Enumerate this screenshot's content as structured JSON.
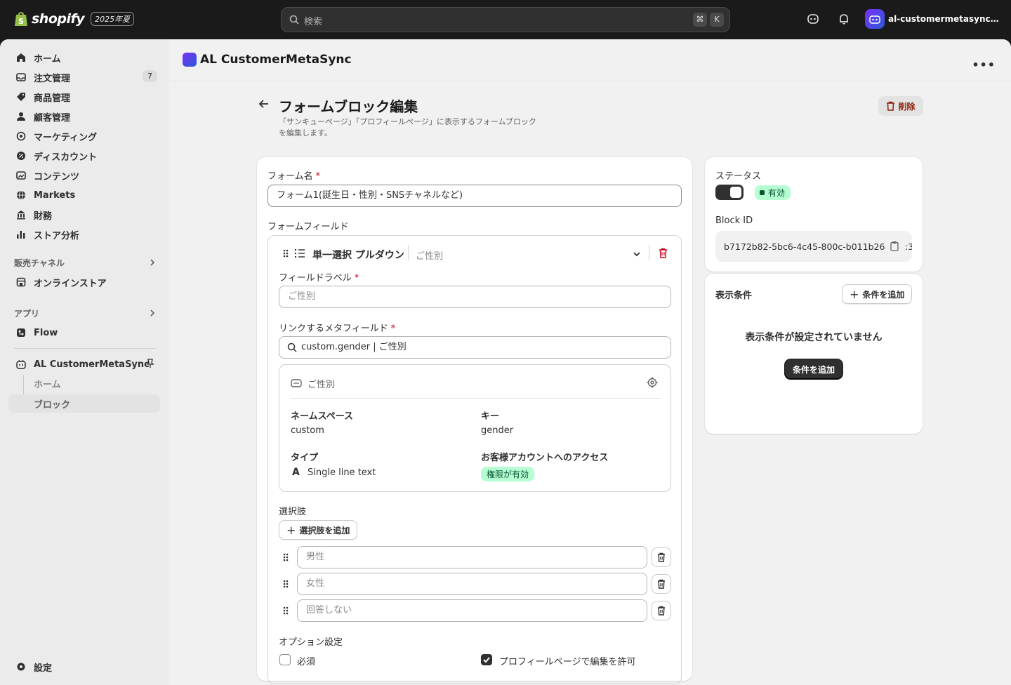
{
  "topbar": {
    "brand": "shopify",
    "edition": "2025年夏",
    "search_placeholder": "検索",
    "shortcut_cmd": "⌘",
    "shortcut_key": "K",
    "store_name": "al-customermetasync-de..."
  },
  "sidebar": {
    "items": [
      {
        "label": "ホーム"
      },
      {
        "label": "注文管理",
        "badge": "7"
      },
      {
        "label": "商品管理"
      },
      {
        "label": "顧客管理"
      },
      {
        "label": "マーケティング"
      },
      {
        "label": "ディスカウント"
      },
      {
        "label": "コンテンツ"
      },
      {
        "label": "Markets"
      },
      {
        "label": "財務"
      },
      {
        "label": "ストア分析"
      }
    ],
    "sales_channels_title": "販売チャネル",
    "online_store": "オンラインストア",
    "apps_title": "アプリ",
    "flow": "Flow",
    "app_name": "AL CustomerMetaSync",
    "app_sub_home": "ホーム",
    "app_sub_block": "ブロック",
    "settings": "設定"
  },
  "app_header": {
    "title": "AL CustomerMetaSync"
  },
  "page": {
    "title": "フォームブロック編集",
    "subtitle": "「サンキューページ」「プロフィールページ」に表示するフォームブロックを編集します。",
    "delete_label": "削除"
  },
  "form": {
    "name_label": "フォーム名",
    "name_value": "フォーム1(誕生日・性別・SNSチャネルなど)",
    "fields_label": "フォームフィールド",
    "field": {
      "type_label": "単一選択 プルダウン",
      "type_sub": "ご性別",
      "field_label_label": "フィールドラベル",
      "field_label_placeholder": "ご性別",
      "metafield_label": "リンクするメタフィールド",
      "metafield_value": "custom.gender | ご性別",
      "meta": {
        "name": "ご性別",
        "namespace_label": "ネームスペース",
        "namespace_value": "custom",
        "key_label": "キー",
        "key_value": "gender",
        "type_label": "タイプ",
        "type_value": "Single line text",
        "access_label": "お客様アカウントへのアクセス",
        "access_value": "権限が有効"
      },
      "choices_label": "選択肢",
      "add_choice_label": "選択肢を追加",
      "choices": [
        {
          "placeholder": "男性"
        },
        {
          "placeholder": "女性"
        },
        {
          "placeholder": "回答しない"
        }
      ],
      "options_label": "オプション設定",
      "required_label": "必須",
      "required_checked": false,
      "profile_edit_label": "プロフィールページで編集を許可",
      "profile_edit_checked": true
    }
  },
  "status_card": {
    "status_label": "ステータス",
    "status_badge": "有効",
    "block_id_label": "Block ID",
    "block_id_value": "b7172b82-5bc6-4c45-800c-b011b26",
    "block_id_tail": ":3"
  },
  "conditions_card": {
    "title": "表示条件",
    "add_label": "条件を追加",
    "empty_text": "表示条件が設定されていません",
    "primary_add_label": "条件を追加"
  }
}
